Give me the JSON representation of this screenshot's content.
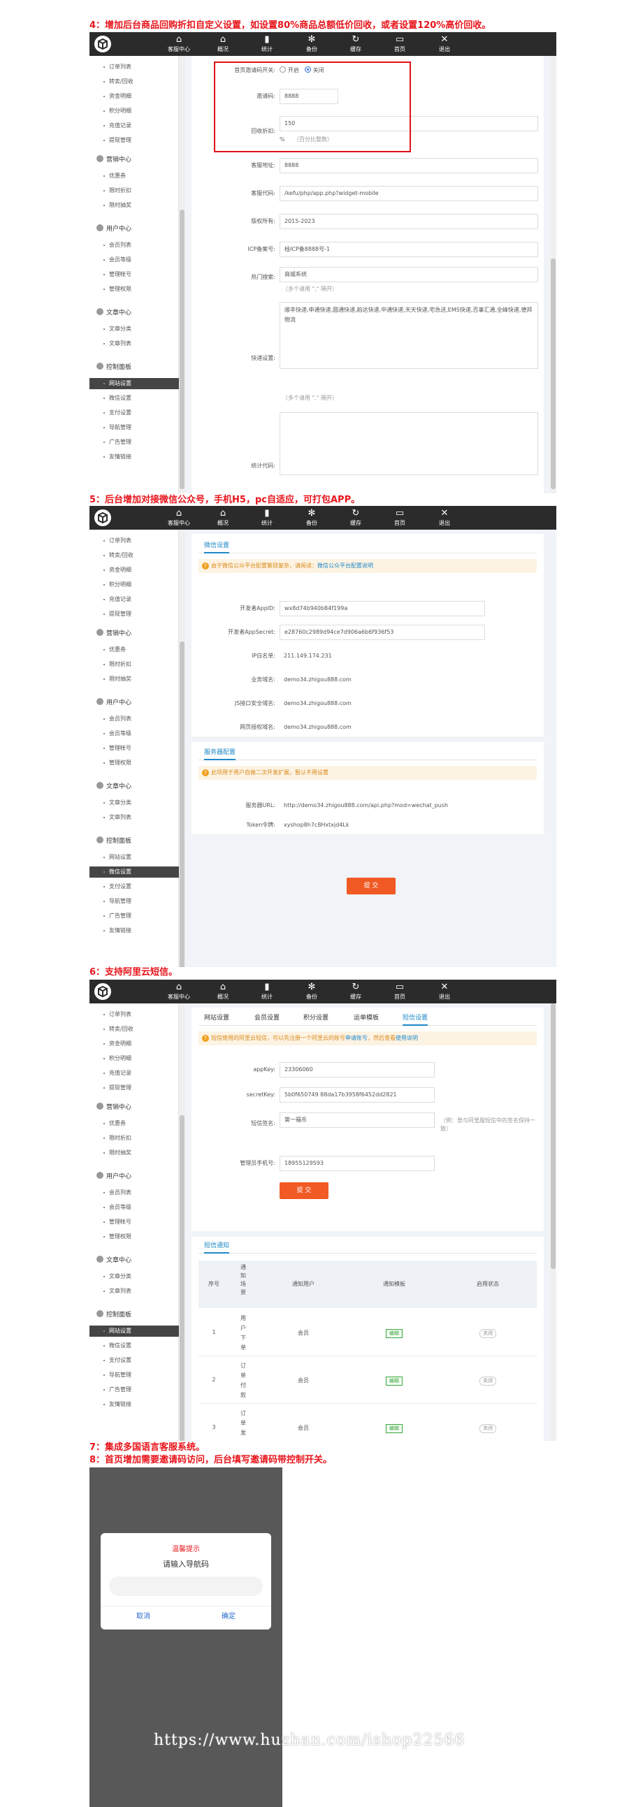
{
  "captions": {
    "c4": "4：增加后台商品回购折扣自定义设置，如设置80%商品总额低价回收，或者设置120%高价回收。",
    "c5": "5：后台增加对接微信公众号，手机H5，pc自适应，可打包APP。",
    "c6": "6：支持阿里云短信。",
    "c7": "7：集成多国语言客服系统。",
    "c8": "8：首页增加需要邀请码访问，后台填写邀请码带控制开关。"
  },
  "topbar": {
    "items": [
      {
        "label": "客服中心",
        "icon": "home-icon"
      },
      {
        "label": "概况",
        "icon": "home-icon"
      },
      {
        "label": "统计",
        "icon": "bar-chart-icon"
      },
      {
        "label": "备份",
        "icon": "gear-icon"
      },
      {
        "label": "缓存",
        "icon": "refresh-icon"
      },
      {
        "label": "首页",
        "icon": "monitor-icon"
      },
      {
        "label": "退出",
        "icon": "close-icon"
      }
    ]
  },
  "sidebar": {
    "top_items": [
      "订单列表",
      "转卖/回收",
      "资金明细",
      "积分明细",
      "充值记录",
      "提现管理"
    ],
    "groups": [
      {
        "label": "营销中心",
        "items": [
          "优惠券",
          "限时折扣",
          "限时抽奖"
        ]
      },
      {
        "label": "用户中心",
        "items": [
          "会员列表",
          "会员等级",
          "管理帐号",
          "管理权限"
        ]
      },
      {
        "label": "文章中心",
        "items": [
          "文章分类",
          "文章列表"
        ]
      },
      {
        "label": "控制面板",
        "items": [
          "网站设置",
          "微信设置",
          "支付设置",
          "导航管理",
          "广告管理",
          "友情链接"
        ]
      }
    ]
  },
  "s1": {
    "invite_switch_label": "首页邀请码开关:",
    "opt_on": "开启",
    "opt_off": "关闭",
    "invite_code_label": "邀请码:",
    "invite_code_value": "8888",
    "recycle_label": "回收折扣:",
    "recycle_value": "150",
    "recycle_unit": "%",
    "recycle_hint": "（百分比整数）",
    "service_addr_label": "客服地址:",
    "service_addr_value": "8888",
    "service_code_label": "客服代码:",
    "service_code_value": "/kefu/php/app.php?widget-mobile",
    "copyright_label": "版权所有:",
    "copyright_value": "2015-2023",
    "icp_label": "ICP备案号:",
    "icp_value": "桂ICP备8888号-1",
    "hot_search_label": "热门搜索:",
    "hot_search_value": "商城系统",
    "hot_search_hint": "（多个请用 \",\" 隔开）",
    "express_label": "快递设置:",
    "express_value": "顺丰快递,申通快递,圆通快递,韵达快递,中通快递,天天快递,宅急送,EMS快递,百事汇通,全峰快递,德邦物流",
    "express_hint": "（多个请用 \",\" 隔开）",
    "stats_label": "统计代码:"
  },
  "s2": {
    "wx_tab": "微信设置",
    "wx_notice_pre": "由于微信公众平台配置繁琐复杂，请阅读：",
    "wx_notice_link": "微信公众平台配置说明",
    "appid_label": "开发者AppID:",
    "appid_value": "wx8d74b940b84f199a",
    "secret_label": "开发者AppSecret:",
    "secret_value": "e28760c2989d94ce7d906a6b6f936f53",
    "ip_label": "IP白名单:",
    "ip_value": "211.149.174.231",
    "biz_domain_label": "业务域名:",
    "biz_domain_value": "demo34.zhigou888.com",
    "js_domain_label": "JS接口安全域名:",
    "js_domain_value": "demo34.zhigou888.com",
    "oauth_domain_label": "网页授权域名:",
    "oauth_domain_value": "demo34.zhigou888.com",
    "server_tab": "服务器配置",
    "server_notice": "此项用于用户自做二次开发扩展，暂认不用设置",
    "server_url_label": "服务器URL:",
    "server_url_value": "http://demo34.zhigou888.com/api.php?mod=wechat_push",
    "token_label": "Token令牌:",
    "token_value": "xyshop8h7c8Hxtxjd4Lk",
    "submit": "提 交"
  },
  "s3": {
    "tabs": [
      "网站设置",
      "会员设置",
      "积分设置",
      "运单模板",
      "短信设置"
    ],
    "notice_pre": "短信使用的阿里云短信，可以先注册一个阿里云的账号",
    "notice_link1": "申请账号",
    "notice_mid": "，然后查看",
    "notice_link2": "使用说明",
    "appkey_label": "appKey:",
    "appkey_value": "23306060",
    "secret_label": "secretKey:",
    "secret_value": "5b0f650749 88da17b3958f6452dd2821",
    "sign_label": "短信签名:",
    "sign_value": "第一福币",
    "sign_hint": "（例：登与阿里服短信中的签名保持一致）",
    "admin_phone_label": "管理员手机号:",
    "admin_phone_value": "18955129593",
    "submit": "提 交",
    "notify_tab": "短信通知",
    "table_headers": [
      "序号",
      "通知场景",
      "通知用户",
      "通知模板",
      "启用状态"
    ],
    "rows": [
      {
        "no": "1",
        "scene": "用户下单",
        "user": "会员",
        "tpl": "编辑",
        "status": "关闭"
      },
      {
        "no": "2",
        "scene": "订单付款",
        "user": "会员",
        "tpl": "编辑",
        "status": "关闭"
      },
      {
        "no": "3",
        "scene": "订单发",
        "user": "会员",
        "tpl": "编辑",
        "status": "关闭"
      }
    ]
  },
  "mobile": {
    "dialog_title": "温馨提示",
    "dialog_msg": "请输入导航码",
    "cancel": "取消",
    "confirm": "确定"
  },
  "watermark": "https://www.huzhan.com/ishop22566"
}
